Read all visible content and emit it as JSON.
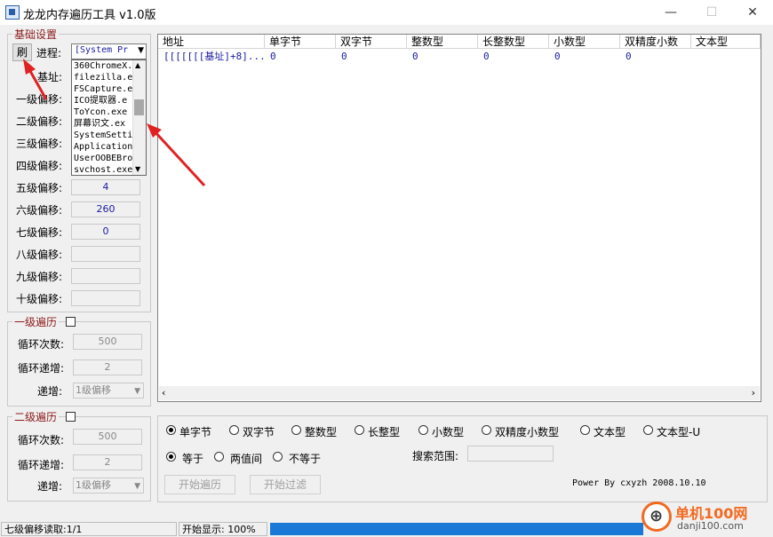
{
  "window": {
    "title": "龙龙内存遍历工具 v1.0版",
    "minimize": "—",
    "maximize": "☐",
    "close": "✕"
  },
  "basic": {
    "group_title": "基础设置",
    "refresh_label": "刷",
    "process_label": "进程:",
    "process_selected": "[System Pr",
    "processes": [
      "360ChromeX.",
      "filezilla.e",
      "FSCapture.e",
      "ICO提取器.e",
      "ToYcon.exe",
      "屏幕识文.ex",
      "SystemSetti",
      "Application",
      "UserOOBEBro",
      "svchost.exe"
    ],
    "base_label": "基址:",
    "offsets": [
      {
        "label": "一级偏移:",
        "value": ""
      },
      {
        "label": "二级偏移:",
        "value": ""
      },
      {
        "label": "三级偏移:",
        "value": ""
      },
      {
        "label": "四级偏移:",
        "value": ""
      },
      {
        "label": "五级偏移:",
        "value": "4"
      },
      {
        "label": "六级偏移:",
        "value": "260"
      },
      {
        "label": "七级偏移:",
        "value": "0"
      },
      {
        "label": "八级偏移:",
        "value": ""
      },
      {
        "label": "九级偏移:",
        "value": ""
      },
      {
        "label": "十级偏移:",
        "value": ""
      }
    ]
  },
  "loop1": {
    "title": "一级遍历",
    "count_label": "循环次数:",
    "count": "500",
    "step_label": "循环递增:",
    "step": "2",
    "inc_label": "递增:",
    "inc_value": "1级偏移"
  },
  "loop2": {
    "title": "二级遍历",
    "count_label": "循环次数:",
    "count": "500",
    "step_label": "循环递增:",
    "step": "2",
    "inc_label": "递增:",
    "inc_value": "1级偏移"
  },
  "table": {
    "columns": [
      "地址",
      "单字节",
      "双字节",
      "整数型",
      "长整数型",
      "小数型",
      "双精度小数",
      "文本型"
    ],
    "rows": [
      [
        "[[[[[[[基址]+8]...",
        "0",
        "0",
        "0",
        "0",
        "0",
        "0",
        ""
      ]
    ]
  },
  "types": [
    "单字节",
    "双字节",
    "整数型",
    "长整型",
    "小数型",
    "双精度小数型",
    "文本型",
    "文本型-U"
  ],
  "compare": [
    "等于",
    "两值间",
    "不等于"
  ],
  "search_range_label": "搜索范围:",
  "start_button": "开始遍历",
  "filter_button": "开始过滤",
  "credit": "Power By cxyzh 2008.10.10",
  "status": {
    "left": "七级偏移读取:1/1",
    "mid": "开始显示: 100%"
  },
  "watermark": {
    "cn": "单机100网",
    "url": "danji100.com"
  },
  "colors": {
    "progress": "#1a78d6",
    "accent_red": "#e02222"
  }
}
